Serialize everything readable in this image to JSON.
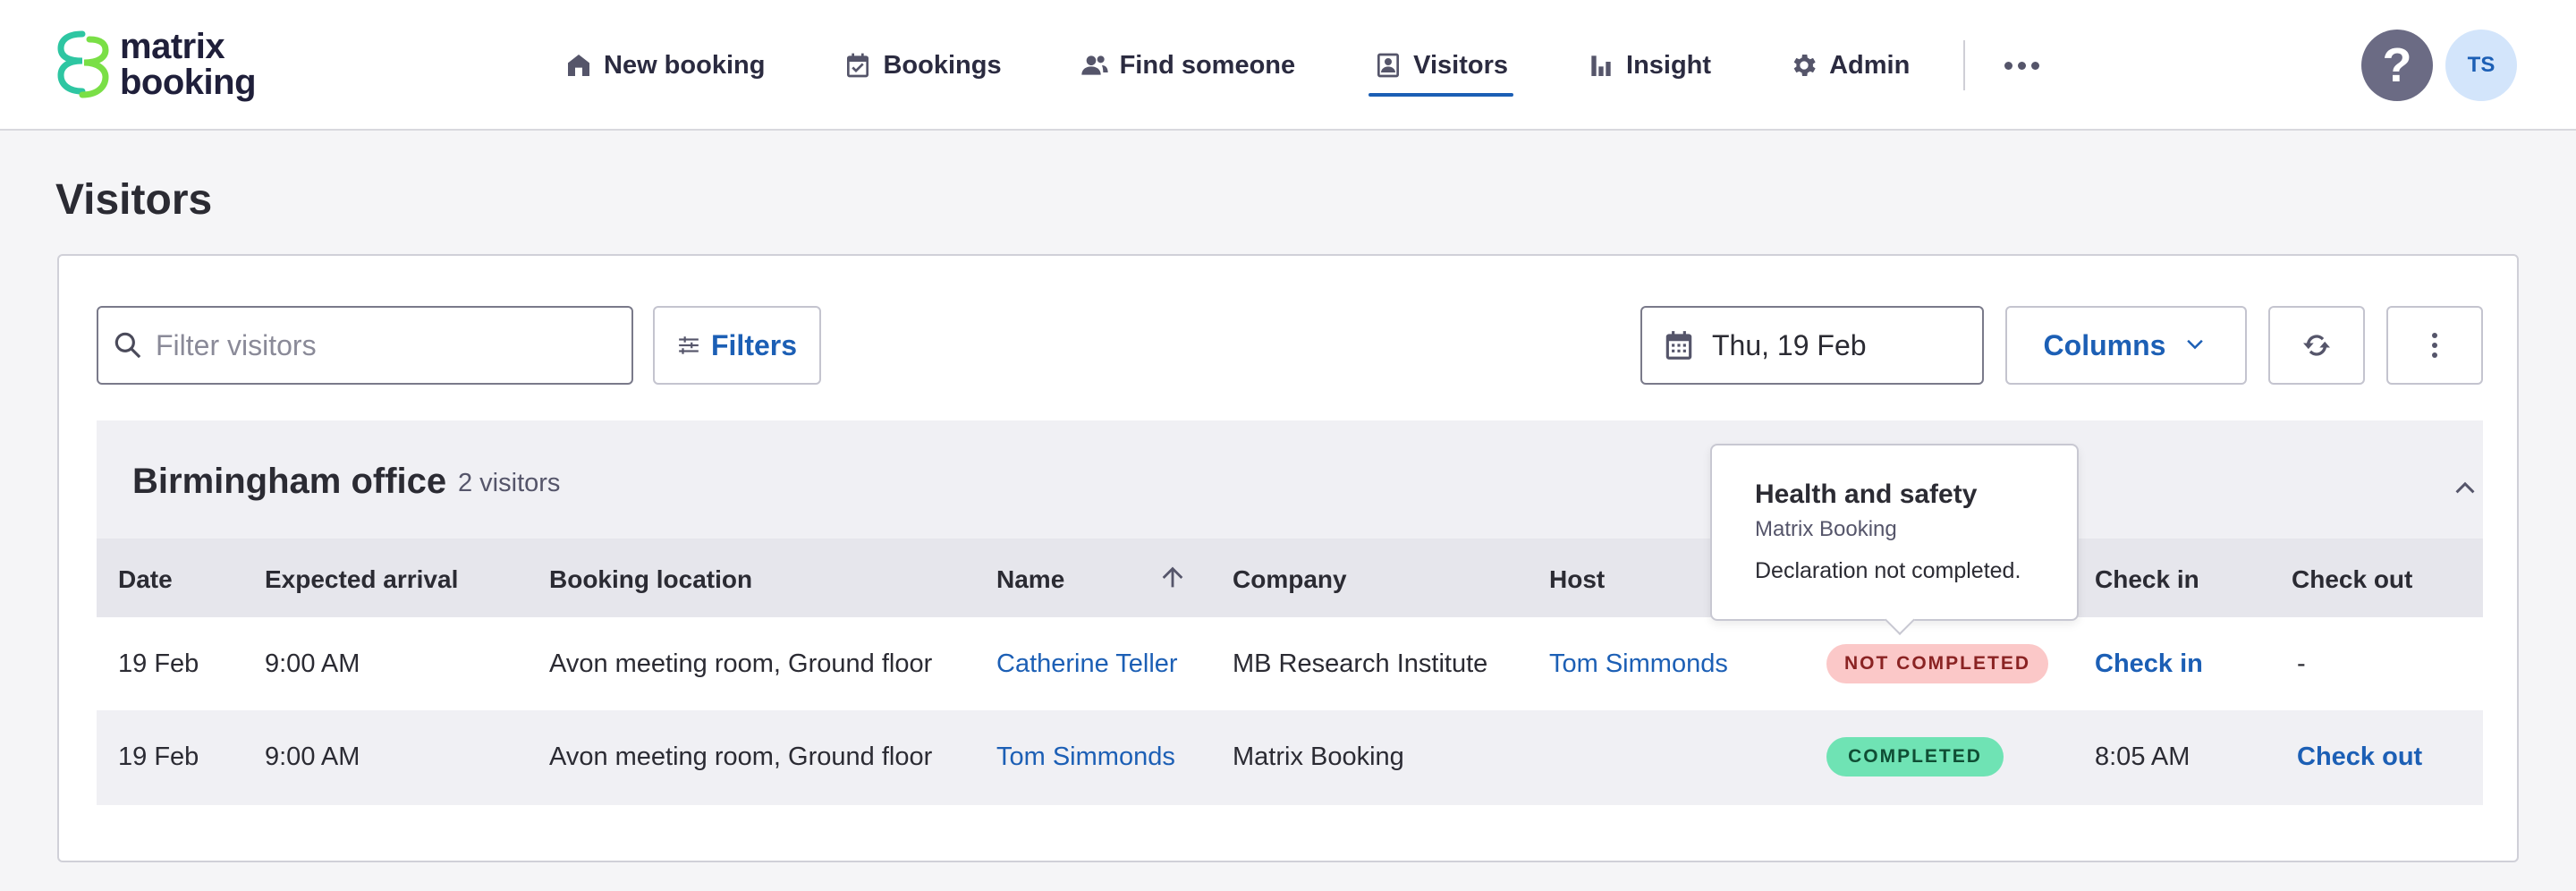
{
  "header": {
    "logo_line1": "matrix",
    "logo_line2": "booking",
    "nav": [
      {
        "label": "New booking",
        "icon": "home-icon"
      },
      {
        "label": "Bookings",
        "icon": "calendar-check-icon"
      },
      {
        "label": "Find someone",
        "icon": "people-icon"
      },
      {
        "label": "Visitors",
        "icon": "visitor-badge-icon",
        "active": true
      },
      {
        "label": "Insight",
        "icon": "bar-chart-icon"
      },
      {
        "label": "Admin",
        "icon": "gear-icon"
      }
    ],
    "help_label": "?",
    "avatar_initials": "TS"
  },
  "page": {
    "title": "Visitors"
  },
  "toolbar": {
    "search_placeholder": "Filter visitors",
    "filters_label": "Filters",
    "date_label": "Thu, 19 Feb",
    "columns_label": "Columns"
  },
  "group": {
    "title": "Birmingham office",
    "count": "2 visitors"
  },
  "table": {
    "columns": [
      "Date",
      "Expected arrival",
      "Booking location",
      "Name",
      "Company",
      "Host",
      "Check in",
      "Check out"
    ],
    "rows": [
      {
        "date": "19 Feb",
        "arrival": "9:00 AM",
        "location": "Avon meeting room, Ground floor",
        "name": "Catherine Teller",
        "company": "MB Research Institute",
        "host": "Tom Simmonds",
        "status": "NOT COMPLETED",
        "check_in": "Check in",
        "check_out": "-"
      },
      {
        "date": "19 Feb",
        "arrival": "9:00 AM",
        "location": "Avon meeting room, Ground floor",
        "name": "Tom Simmonds",
        "company": "Matrix Booking",
        "host": "",
        "status": "COMPLETED",
        "check_in": "8:05 AM",
        "check_out": "Check out"
      }
    ]
  },
  "tooltip": {
    "title": "Health and safety",
    "subtitle": "Matrix Booking",
    "message": "Declaration not completed."
  },
  "colors": {
    "accent": "#1c5fb5",
    "not_completed_bg": "#fbc8c8",
    "completed_bg": "#6fe3b4",
    "logo_green": "#37d27a"
  }
}
